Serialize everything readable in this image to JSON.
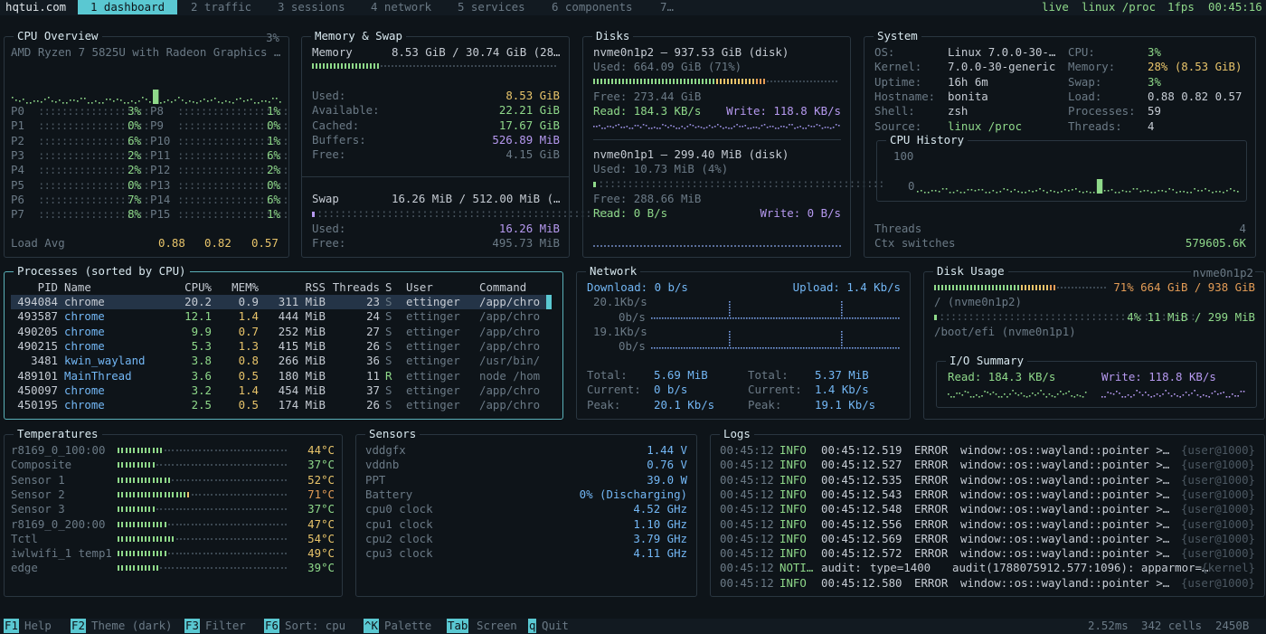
{
  "topbar": {
    "brand": "hqtui.com",
    "tabs": [
      "1 dashboard",
      "2 traffic",
      "3 sessions",
      "4 network",
      "5 services",
      "6 components",
      "7…"
    ],
    "live": "live",
    "source": "linux /proc",
    "fps": "1fps",
    "time": "00:45:16"
  },
  "cpu": {
    "title": "CPU Overview",
    "pct": "3%",
    "model": "AMD Ryzen 7 5825U with Radeon Graphics …",
    "cores_left": [
      {
        "n": "P0",
        "v": "3%"
      },
      {
        "n": "P1",
        "v": "0%"
      },
      {
        "n": "P2",
        "v": "6%"
      },
      {
        "n": "P3",
        "v": "2%"
      },
      {
        "n": "P4",
        "v": "2%"
      },
      {
        "n": "P5",
        "v": "0%"
      },
      {
        "n": "P6",
        "v": "7%"
      },
      {
        "n": "P7",
        "v": "8%"
      }
    ],
    "cores_right": [
      {
        "n": "P8",
        "v": "1%"
      },
      {
        "n": "P9",
        "v": "0%"
      },
      {
        "n": "P10",
        "v": "1%"
      },
      {
        "n": "P11",
        "v": "6%"
      },
      {
        "n": "P12",
        "v": "2%"
      },
      {
        "n": "P13",
        "v": "0%"
      },
      {
        "n": "P14",
        "v": "6%"
      },
      {
        "n": "P15",
        "v": "1%"
      }
    ],
    "load_label": "Load Avg",
    "load": [
      "0.88",
      "0.82",
      "0.57"
    ]
  },
  "memory": {
    "title": "Memory & Swap",
    "mem_label": "Memory",
    "mem_summary": "8.53 GiB / 30.74 GiB (28…",
    "rows": [
      {
        "k": "Used:",
        "v": "8.53 GiB"
      },
      {
        "k": "Available:",
        "v": "22.21 GiB"
      },
      {
        "k": "Cached:",
        "v": "17.67 GiB"
      },
      {
        "k": "Buffers:",
        "v": "526.89 MiB"
      },
      {
        "k": "Free:",
        "v": "4.15 GiB"
      }
    ],
    "swap_label": "Swap",
    "swap_summary": "16.26 MiB / 512.00 MiB (…",
    "swap_rows": [
      {
        "k": "Used:",
        "v": "16.26 MiB"
      },
      {
        "k": "Free:",
        "v": "495.73 MiB"
      }
    ]
  },
  "disks": {
    "title": "Disks",
    "d1": {
      "name": "nvme0n1p2 — 937.53 GiB (disk)",
      "used": "Used: 664.09 GiB (71%)",
      "free": "Free: 273.44 GiB",
      "read": "Read: 184.3 KB/s",
      "write": "Write: 118.8 KB/s"
    },
    "d2": {
      "name": "nvme0n1p1 — 299.40 MiB (disk)",
      "used": "Used: 10.73 MiB (4%)",
      "free": "Free: 288.66 MiB",
      "read": "Read: 0 B/s",
      "write": "Write: 0 B/s"
    }
  },
  "system": {
    "title": "System",
    "left": [
      {
        "k": "OS:",
        "v": "Linux 7.0.0-30-…"
      },
      {
        "k": "Kernel:",
        "v": "7.0.0-30-generic"
      },
      {
        "k": "Uptime:",
        "v": "16h 6m"
      },
      {
        "k": "Hostname:",
        "v": "bonita"
      },
      {
        "k": "Shell:",
        "v": "zsh"
      },
      {
        "k": "Source:",
        "v": "linux /proc"
      }
    ],
    "right": [
      {
        "k": "CPU:",
        "v": "3%"
      },
      {
        "k": "Memory:",
        "v": "28% (8.53 GiB)"
      },
      {
        "k": "Swap:",
        "v": "3%"
      },
      {
        "k": "Load:",
        "v": "0.88 0.82 0.57"
      },
      {
        "k": "Processes:",
        "v": "59"
      },
      {
        "k": "Threads:",
        "v": "4"
      }
    ],
    "history_title": "CPU History",
    "h100": "100",
    "h0": "0",
    "threads_label": "Threads",
    "threads": "4",
    "ctx_label": "Ctx switches",
    "ctx": "579605.6K"
  },
  "processes": {
    "title": "Processes (sorted by CPU)",
    "headers": [
      "PID",
      "Name",
      "CPU%",
      "MEM%",
      "RSS",
      "Threads",
      "S",
      "User",
      "Command"
    ],
    "rows": [
      [
        "494084",
        "chrome",
        "20.2",
        "0.9",
        "311 MiB",
        "23",
        "S",
        "ettinger",
        "/app/chro"
      ],
      [
        "493587",
        "chrome",
        "12.1",
        "1.4",
        "444 MiB",
        "24",
        "S",
        "ettinger",
        "/app/chro"
      ],
      [
        "490205",
        "chrome",
        "9.9",
        "0.7",
        "252 MiB",
        "27",
        "S",
        "ettinger",
        "/app/chro"
      ],
      [
        "490215",
        "chrome",
        "5.3",
        "1.3",
        "415 MiB",
        "26",
        "S",
        "ettinger",
        "/app/chro"
      ],
      [
        "3481",
        "kwin_wayland",
        "3.8",
        "0.8",
        "266 MiB",
        "36",
        "S",
        "ettinger",
        "/usr/bin/"
      ],
      [
        "489101",
        "MainThread",
        "3.6",
        "0.5",
        "180 MiB",
        "11",
        "R",
        "ettinger",
        "node /hom"
      ],
      [
        "450097",
        "chrome",
        "3.2",
        "1.4",
        "454 MiB",
        "37",
        "S",
        "ettinger",
        "/app/chro"
      ],
      [
        "450195",
        "chrome",
        "2.5",
        "0.5",
        "174 MiB",
        "26",
        "S",
        "ettinger",
        "/app/chro"
      ]
    ]
  },
  "network": {
    "title": "Network",
    "download": "Download: 0 b/s",
    "upload": "Upload: 1.4 Kb/s",
    "ticks": [
      "20.1Kb/s",
      "0b/s",
      "19.1Kb/s",
      "0b/s"
    ],
    "left": [
      {
        "k": "Total:",
        "v": "5.69 MiB"
      },
      {
        "k": "Current:",
        "v": "0 b/s"
      },
      {
        "k": "Peak:",
        "v": "20.1 Kb/s"
      }
    ],
    "right": [
      {
        "k": "Total:",
        "v": "5.37 MiB"
      },
      {
        "k": "Current:",
        "v": "1.4 Kb/s"
      },
      {
        "k": "Peak:",
        "v": "19.1 Kb/s"
      }
    ]
  },
  "diskusage": {
    "title": "Disk Usage",
    "device": "nvme0n1p2",
    "d1": {
      "pct": 0.71,
      "summary": "71% 664 GiB / 938 GiB",
      "mount": "/ (nvme0n1p2)"
    },
    "d2": {
      "pct": 0.04,
      "summary": "4% 11 MiB / 299 MiB",
      "mount": "/boot/efi (nvme0n1p1)"
    },
    "io_title": "I/O Summary",
    "io_read": "Read: 184.3 KB/s",
    "io_write": "Write: 118.8 KB/s"
  },
  "temps": {
    "title": "Temperatures",
    "rows": [
      {
        "n": "r8169_0_100:00",
        "v": "44°C",
        "lvl": 0.44
      },
      {
        "n": "Composite",
        "v": "37°C",
        "lvl": 0.37
      },
      {
        "n": "Sensor 1",
        "v": "52°C",
        "lvl": 0.52
      },
      {
        "n": "Sensor 2",
        "v": "71°C",
        "lvl": 0.71
      },
      {
        "n": "Sensor 3",
        "v": "37°C",
        "lvl": 0.37
      },
      {
        "n": "r8169_0_200:00",
        "v": "47°C",
        "lvl": 0.47
      },
      {
        "n": "Tctl",
        "v": "54°C",
        "lvl": 0.54
      },
      {
        "n": "iwlwifi_1 temp1",
        "v": "49°C",
        "lvl": 0.49
      },
      {
        "n": "edge",
        "v": "39°C",
        "lvl": 0.39
      }
    ]
  },
  "sensors": {
    "title": "Sensors",
    "rows": [
      {
        "k": "vddgfx",
        "v": "1.44 V"
      },
      {
        "k": "vddnb",
        "v": "0.76 V"
      },
      {
        "k": "PPT",
        "v": "39.0 W"
      },
      {
        "k": "Battery",
        "v": "0% (Discharging)"
      },
      {
        "k": "cpu0 clock",
        "v": "4.52 GHz"
      },
      {
        "k": "cpu1 clock",
        "v": "1.10 GHz"
      },
      {
        "k": "cpu2 clock",
        "v": "3.79 GHz"
      },
      {
        "k": "cpu3 clock",
        "v": "4.11 GHz"
      }
    ]
  },
  "logs": {
    "title": "Logs",
    "rows": [
      {
        "t": "00:45:12",
        "lv": "INFO",
        "ts": "00:45:12.519",
        "tag": "ERROR",
        "msg": "window::os::wayland::pointer >…",
        "src": "{user@1000}"
      },
      {
        "t": "00:45:12",
        "lv": "INFO",
        "ts": "00:45:12.527",
        "tag": "ERROR",
        "msg": "window::os::wayland::pointer >…",
        "src": "{user@1000}"
      },
      {
        "t": "00:45:12",
        "lv": "INFO",
        "ts": "00:45:12.535",
        "tag": "ERROR",
        "msg": "window::os::wayland::pointer >…",
        "src": "{user@1000}"
      },
      {
        "t": "00:45:12",
        "lv": "INFO",
        "ts": "00:45:12.543",
        "tag": "ERROR",
        "msg": "window::os::wayland::pointer >…",
        "src": "{user@1000}"
      },
      {
        "t": "00:45:12",
        "lv": "INFO",
        "ts": "00:45:12.548",
        "tag": "ERROR",
        "msg": "window::os::wayland::pointer >…",
        "src": "{user@1000}"
      },
      {
        "t": "00:45:12",
        "lv": "INFO",
        "ts": "00:45:12.556",
        "tag": "ERROR",
        "msg": "window::os::wayland::pointer >…",
        "src": "{user@1000}"
      },
      {
        "t": "00:45:12",
        "lv": "INFO",
        "ts": "00:45:12.569",
        "tag": "ERROR",
        "msg": "window::os::wayland::pointer >…",
        "src": "{user@1000}"
      },
      {
        "t": "00:45:12",
        "lv": "INFO",
        "ts": "00:45:12.572",
        "tag": "ERROR",
        "msg": "window::os::wayland::pointer >…",
        "src": "{user@1000}"
      },
      {
        "t": "00:45:12",
        "lv": "NOTI…",
        "ts": "audit:",
        "tag": "type=1400",
        "msg": "audit(1788075912.577:1096): apparmor=…",
        "src": "{kernel}"
      },
      {
        "t": "00:45:12",
        "lv": "INFO",
        "ts": "00:45:12.580",
        "tag": "ERROR",
        "msg": "window::os::wayland::pointer >…",
        "src": "{user@1000}"
      }
    ]
  },
  "statusbar": {
    "keys": [
      {
        "k": "F1",
        "l": "Help"
      },
      {
        "k": "F2",
        "l": "Theme (dark)"
      },
      {
        "k": "F3",
        "l": "Filter"
      },
      {
        "k": "F6",
        "l": "Sort: cpu"
      },
      {
        "k": "^K",
        "l": "Palette"
      },
      {
        "k": "Tab",
        "l": "Screen"
      },
      {
        "k": "q",
        "l": "Quit"
      }
    ],
    "timing": "2.52ms",
    "cells": "342 cells",
    "bytes": "2450B"
  }
}
